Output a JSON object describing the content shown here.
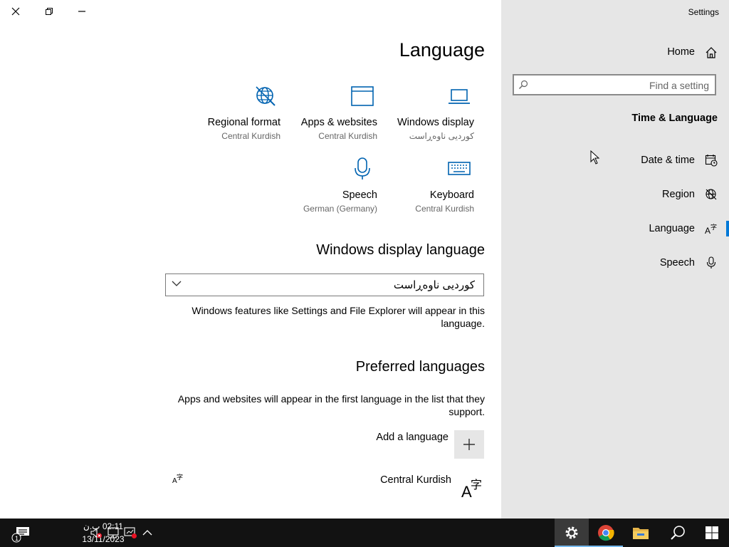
{
  "window": {
    "app_title": "Settings",
    "page_title": "Language"
  },
  "tiles": [
    {
      "label": "Regional format",
      "sub": "Central Kurdish",
      "icon": "globe-icon"
    },
    {
      "label": "Apps & websites",
      "sub": "Central Kurdish",
      "icon": "browser-window-icon"
    },
    {
      "label": "Windows display",
      "sub": "کوردیی ناوەڕاست",
      "icon": "laptop-icon"
    },
    {
      "label": "Speech",
      "sub": "German (Germany)",
      "icon": "microphone-icon"
    },
    {
      "label": "Keyboard",
      "sub": "Central Kurdish",
      "icon": "keyboard-icon"
    }
  ],
  "display_language": {
    "heading": "Windows display language",
    "selected": "کوردیی ناوەڕاست",
    "description": "Windows features like Settings and File Explorer will appear in this language."
  },
  "preferred": {
    "heading": "Preferred languages",
    "description": "Apps and websites will appear in the first language in the list that they support.",
    "add_label": "Add a language",
    "languages": [
      {
        "name": "Central Kurdish"
      }
    ]
  },
  "sidebar": {
    "home_label": "Home",
    "search_placeholder": "Find a setting",
    "section_title": "Time & Language",
    "items": [
      {
        "label": "Date & time",
        "icon": "calendar-clock-icon"
      },
      {
        "label": "Region",
        "icon": "globe-icon"
      },
      {
        "label": "Language",
        "icon": "language-icon",
        "active": true
      },
      {
        "label": "Speech",
        "icon": "microphone-icon"
      }
    ]
  },
  "taskbar": {
    "time": "02:11 پ.ن",
    "date": "13/11/2023"
  },
  "colors": {
    "accent": "#0078d7",
    "sidebar_bg": "#e6e6e6",
    "taskbar_bg": "#121212"
  }
}
